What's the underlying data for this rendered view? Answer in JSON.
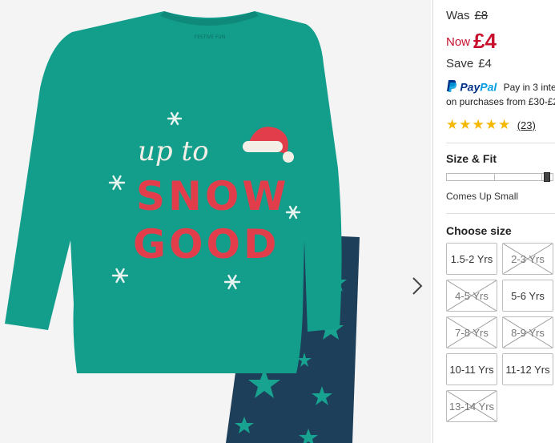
{
  "price": {
    "was_label": "Was",
    "was_value": "£8",
    "now_label": "Now",
    "now_value": "£4",
    "save_label": "Save",
    "save_value": "£4"
  },
  "paypal": {
    "logo_pay": "Pay",
    "logo_pal": "Pal",
    "message_line1": "Pay in 3 inte",
    "message_line2": "on purchases from £30-£2"
  },
  "rating": {
    "stars": 5,
    "review_count": "(23)"
  },
  "size_fit": {
    "title": "Size & Fit",
    "fit_position": 0.95,
    "fit_label": "Comes Up Small"
  },
  "choose_size": {
    "title": "Choose size",
    "sizes": [
      {
        "label": "1.5-2 Yrs",
        "available": true
      },
      {
        "label": "2-3 Yrs",
        "available": false
      },
      {
        "label": "4-5 Yrs",
        "available": false
      },
      {
        "label": "5-6 Yrs",
        "available": true
      },
      {
        "label": "7-8 Yrs",
        "available": false
      },
      {
        "label": "8-9 Yrs",
        "available": false
      },
      {
        "label": "10-11 Yrs",
        "available": true
      },
      {
        "label": "11-12 Yrs",
        "available": true
      },
      {
        "label": "13-14 Yrs",
        "available": false
      }
    ]
  },
  "product_image": {
    "shirt_text_line1": "up to",
    "shirt_text_line2": "SNOW",
    "shirt_text_line3": "GOOD",
    "neck_label": "FESTIVE FUN",
    "colors": {
      "background": "#f4f4f4",
      "shirt": "#139e8c",
      "pants": "#1d3f5a",
      "stars_on_pants": "#17a390",
      "red_text": "#e23d4b"
    }
  },
  "colors": {
    "price_red": "#c8102e",
    "star_gold": "#f5b800",
    "paypal_dark": "#003087",
    "paypal_light": "#009cde"
  }
}
